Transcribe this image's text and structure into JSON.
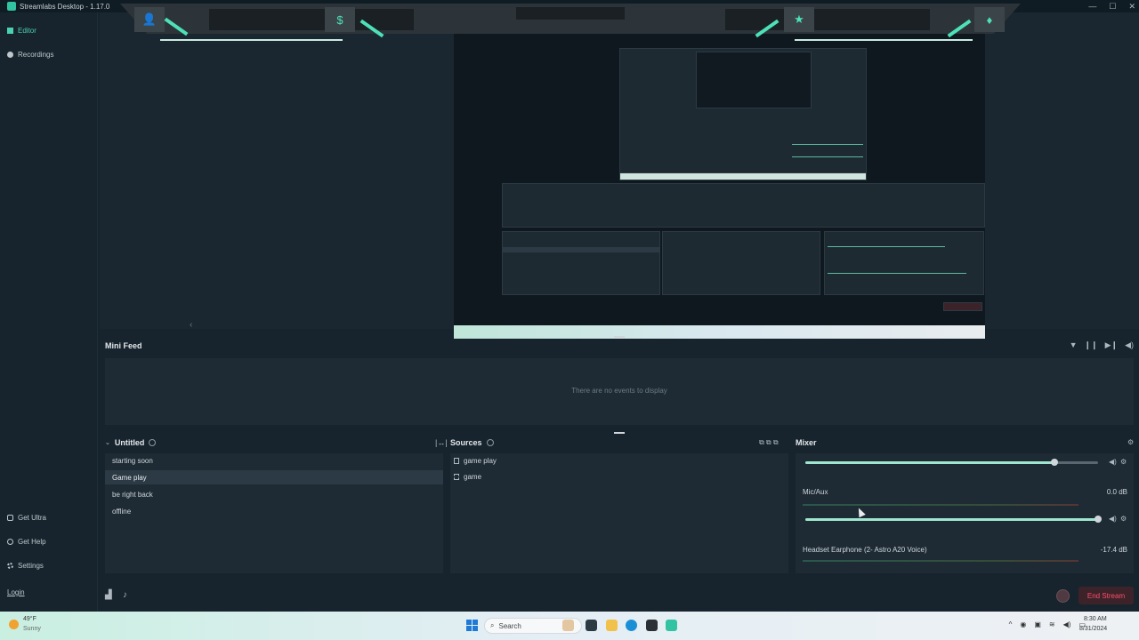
{
  "window": {
    "title": "Streamlabs Desktop - 1.17.0",
    "controls": [
      "—",
      "☐",
      "✕"
    ]
  },
  "sidebar": {
    "items": [
      {
        "label": "Editor",
        "icon": "editor-icon"
      },
      {
        "label": "Recordings",
        "icon": "recordings-icon"
      }
    ],
    "bottom_items": [
      {
        "label": "Get Ultra",
        "icon": "ultra-icon"
      },
      {
        "label": "Get Help",
        "icon": "help-icon"
      },
      {
        "label": "Settings",
        "icon": "gear-icon"
      }
    ],
    "login": "Login"
  },
  "overlay": {
    "accent": "#4ee0b8",
    "gem_icons": [
      "👤",
      "$",
      "★",
      "♦"
    ]
  },
  "mini_feed": {
    "title": "Mini Feed",
    "empty_text": "There are no events to display",
    "icons": [
      "filter-icon",
      "pause-icon",
      "skip-icon",
      "volume-icon"
    ]
  },
  "scenes": {
    "title": "Untitled",
    "items": [
      "starting soon",
      "Game play",
      "be right back",
      "offline"
    ],
    "selected": "Game play"
  },
  "sources": {
    "title": "Sources",
    "items": [
      {
        "label": "game play",
        "icon": "file-icon"
      },
      {
        "label": "game",
        "icon": "capture-icon"
      }
    ]
  },
  "mixer": {
    "title": "Mixer",
    "tracks": [
      {
        "name": "Mic/Aux",
        "db": "0.0 dB",
        "level": 1.0
      },
      {
        "name": "Headset Earphone (2- Astro A20 Voice)",
        "db": "-17.4 dB",
        "level": 1.0
      }
    ],
    "top_slider_level": 0.85
  },
  "footer": {
    "end_stream": "End Stream"
  },
  "taskbar": {
    "temp": "49°F",
    "condition": "Sunny",
    "search": "Search",
    "time": "8:30 AM",
    "date": "8/31/2024"
  }
}
